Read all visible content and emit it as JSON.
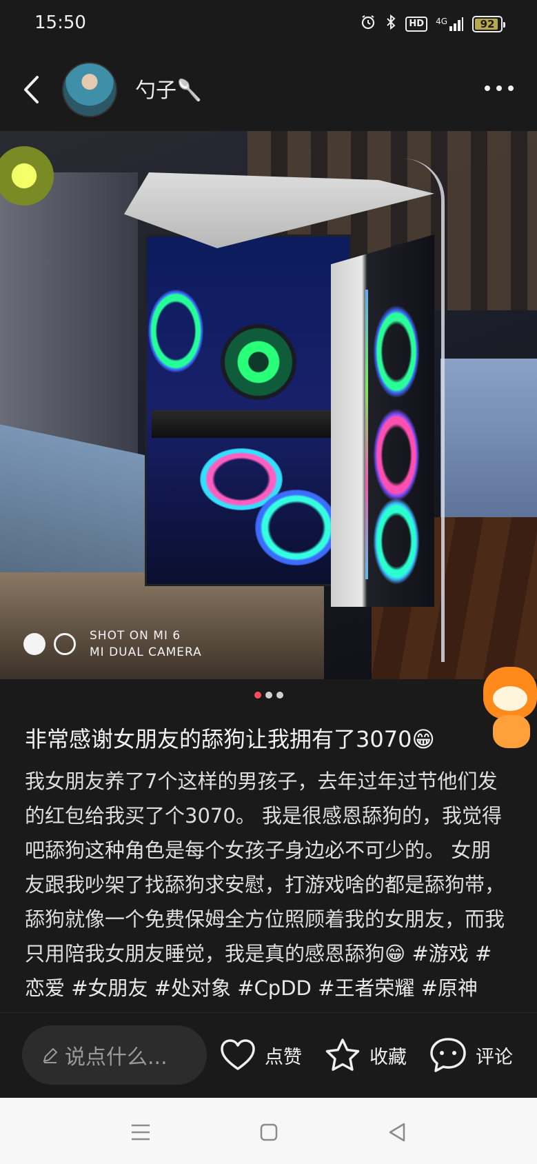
{
  "status_bar": {
    "time": "15:50",
    "network": "4G",
    "hd": "HD",
    "battery": "92",
    "battery_level_percent": 92,
    "icons": [
      "alarm-icon",
      "bluetooth-icon",
      "hd-icon",
      "signal-icon",
      "battery-icon"
    ]
  },
  "header": {
    "username": "勺子🥄",
    "icons": [
      "back-arrow-icon",
      "avatar",
      "more-icon"
    ]
  },
  "photo": {
    "watermark_line1": "SHOT ON MI 6",
    "watermark_line2": "MI DUAL CAMERA",
    "page_total": 3,
    "page_current": 1
  },
  "post": {
    "title": "非常感谢女朋友的舔狗让我拥有了3070😁",
    "body": "我女朋友养了7个这样的男孩子，去年过年过节他们发的红包给我买了个3070。 我是很感恩舔狗的，我觉得吧舔狗这种角色是每个女孩子身边必不可少的。 女朋友跟我吵架了找舔狗求安慰，打游戏啥的都是舔狗带，舔狗就像一个免费保姆全方位照顾着我的女朋友，而我只用陪我女朋友睡觉，我是真的感恩舔狗😁",
    "hashtags": "#游戏 #恋爱 #女朋友 #处对象 #CpDD #王者荣耀 #原神"
  },
  "actions": {
    "comment_placeholder": "说点什么...",
    "like_label": "点赞",
    "favorite_label": "收藏",
    "comment_label": "评论"
  },
  "colors": {
    "background": "#1a1a1a",
    "pager_active": "#ff4b5c",
    "input_bg": "#2c2c2c",
    "nav_bar": "#f7f7f7"
  }
}
